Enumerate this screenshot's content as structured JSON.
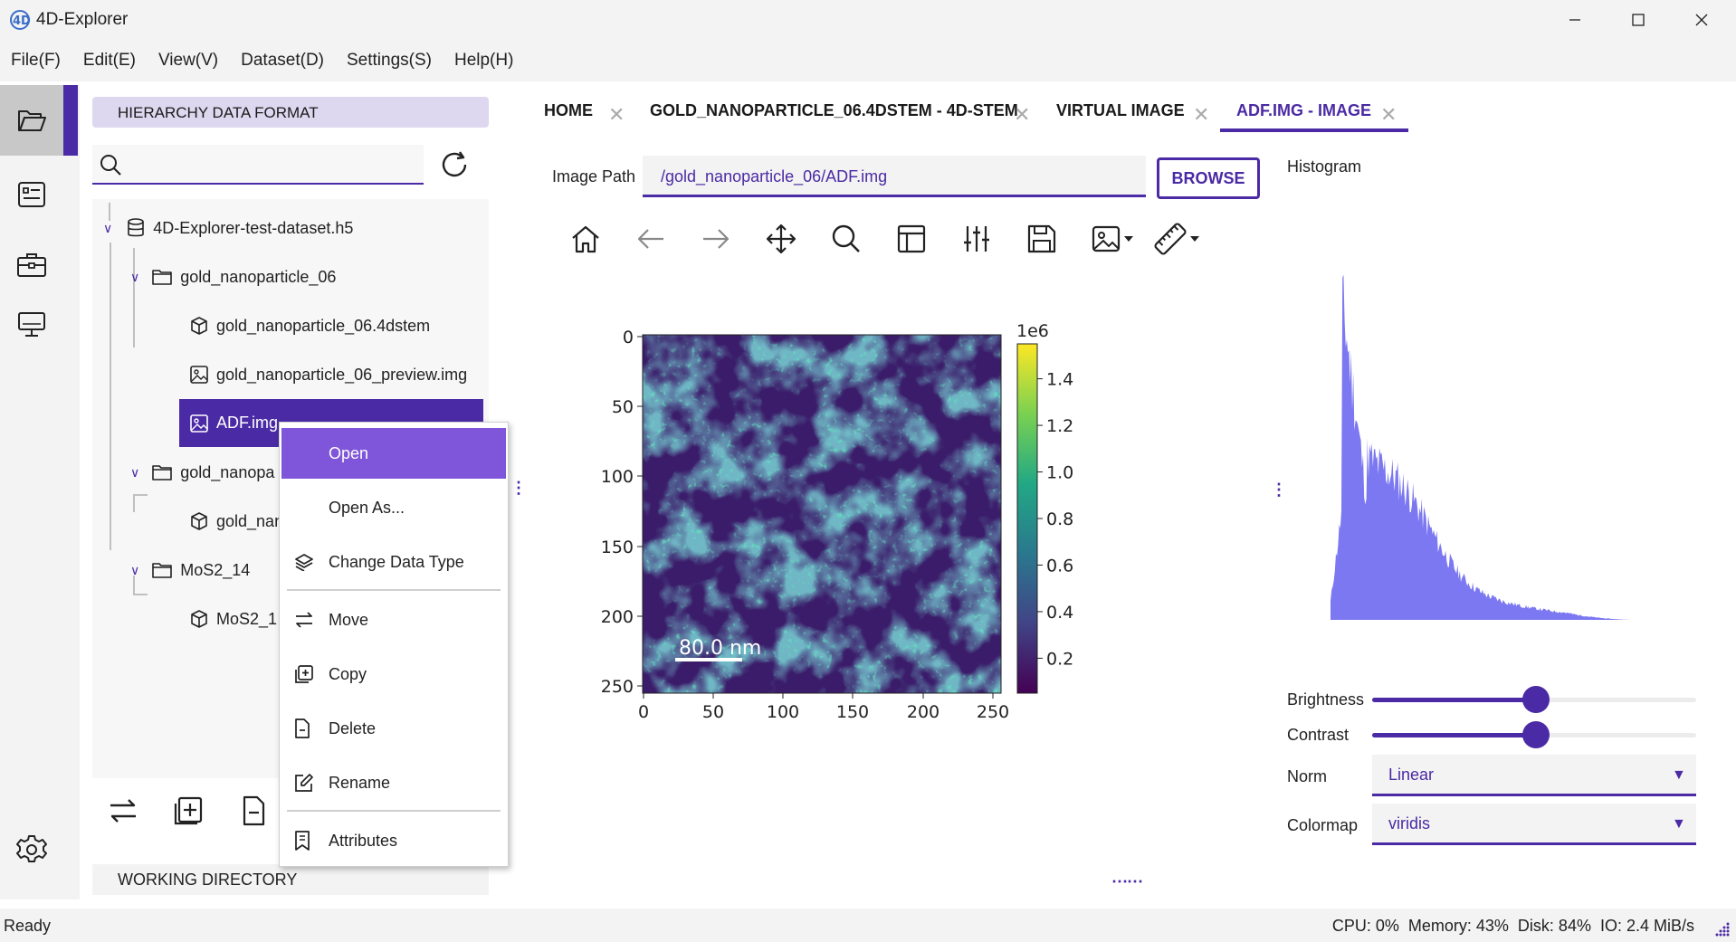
{
  "app": {
    "title": "4D-Explorer"
  },
  "menubar": {
    "items": [
      "File(F)",
      "Edit(E)",
      "View(V)",
      "Dataset(D)",
      "Settings(S)",
      "Help(H)"
    ]
  },
  "activitybar": {
    "items": [
      "folder-open-icon",
      "document-list-icon",
      "toolbox-icon",
      "monitor-icon"
    ],
    "settings": "gear-icon"
  },
  "explorer": {
    "header": "HIERARCHY DATA FORMAT",
    "search": {
      "value": "",
      "placeholder": ""
    },
    "tree": {
      "root": "4D-Explorer-test-dataset.h5",
      "group1": "gold_nanoparticle_06",
      "g1_item1": "gold_nanoparticle_06.4dstem",
      "g1_item2": "gold_nanoparticle_06_preview.img",
      "g1_item3": "ADF.img",
      "group2": "gold_nanopa",
      "g2_item1": "gold_nan",
      "group3": "MoS2_14",
      "g3_item1": "MoS2_1"
    },
    "working_directory": "WORKING DIRECTORY"
  },
  "context_menu": {
    "items": [
      {
        "label": "Open",
        "icon": "none",
        "highlighted": true
      },
      {
        "label": "Open As...",
        "icon": "none"
      },
      {
        "label": "Change Data Type",
        "icon": "layers-icon"
      },
      {
        "label": "Move",
        "icon": "swap-icon"
      },
      {
        "label": "Copy",
        "icon": "copy-icon"
      },
      {
        "label": "Delete",
        "icon": "delete-file-icon"
      },
      {
        "label": "Rename",
        "icon": "edit-icon"
      },
      {
        "label": "Attributes",
        "icon": "bookmark-icon"
      }
    ]
  },
  "tabs": [
    {
      "label": "HOME",
      "active": false
    },
    {
      "label": "GOLD_NANOPARTICLE_06.4DSTEM - 4D-STEM",
      "active": false
    },
    {
      "label": "VIRTUAL IMAGE",
      "active": false
    },
    {
      "label": "ADF.IMG - IMAGE",
      "active": true
    }
  ],
  "image_path": {
    "label": "Image Path",
    "value": "/gold_nanoparticle_06/ADF.img",
    "browse": "BROWSE"
  },
  "toolbar": [
    "home-icon",
    "back-arrow-icon",
    "forward-arrow-icon",
    "pan-move-icon",
    "zoom-icon",
    "subplot-layout-icon",
    "adjust-sliders-icon",
    "save-icon",
    "image-menu-icon",
    "ruler-menu-icon"
  ],
  "plot": {
    "x_ticks": [
      "0",
      "50",
      "100",
      "150",
      "200",
      "250"
    ],
    "y_ticks": [
      "0",
      "50",
      "100",
      "150",
      "200",
      "250"
    ],
    "colorbar": {
      "exponent": "1e6",
      "ticks": [
        "1.4",
        "1.2",
        "1.0",
        "0.8",
        "0.6",
        "0.4",
        "0.2"
      ],
      "min": 0.05,
      "max": 1.55
    },
    "scalebar": "80.0 nm",
    "colormap": "viridis"
  },
  "histogram": {
    "title": "Histogram",
    "color": "#7b78f2"
  },
  "controls": {
    "brightness": {
      "label": "Brightness",
      "value": 0.5
    },
    "contrast": {
      "label": "Contrast",
      "value": 0.5
    },
    "norm": {
      "label": "Norm",
      "value": "Linear"
    },
    "colormap": {
      "label": "Colormap",
      "value": "viridis"
    }
  },
  "status": {
    "text": "Ready",
    "stats": "CPU: 0%  Memory: 43%  Disk: 84%  IO: 2.4 MiB/s"
  },
  "colors": {
    "accent": "#4b2aa5",
    "menu_highlight": "#7f56d9",
    "header_bg": "#ddd8ef"
  }
}
